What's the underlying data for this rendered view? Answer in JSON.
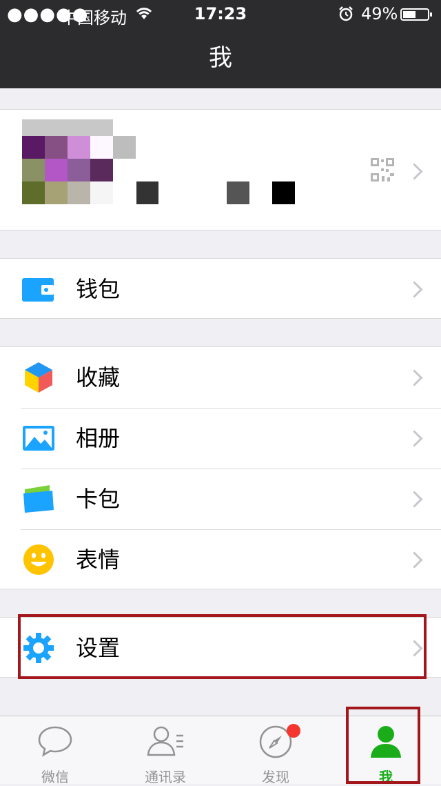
{
  "status": {
    "signal": "●●●●●",
    "carrier": "中国移动",
    "time": "17:23",
    "battery": "49%",
    "battery_level": 0.49
  },
  "nav": {
    "title": "我"
  },
  "profile": {
    "qr_icon": "qr-code-icon",
    "chevron": "chevron-right-icon"
  },
  "groups": {
    "wallet": [
      {
        "label": "钱包",
        "icon": "wallet-icon",
        "color": "#1aa3ff"
      }
    ],
    "media": [
      {
        "label": "收藏",
        "icon": "favorites-cube-icon"
      },
      {
        "label": "相册",
        "icon": "album-icon",
        "color": "#1aa3ff"
      },
      {
        "label": "卡包",
        "icon": "card-package-icon",
        "color": "#1aa3ff"
      },
      {
        "label": "表情",
        "icon": "emoji-smile-icon",
        "color": "#ffc300"
      }
    ],
    "settings": [
      {
        "label": "设置",
        "icon": "gear-icon",
        "color": "#1aa3ff"
      }
    ]
  },
  "tabs": [
    {
      "label": "微信",
      "icon": "chat-bubble-icon",
      "active": false
    },
    {
      "label": "通讯录",
      "icon": "contacts-icon",
      "active": false
    },
    {
      "label": "发现",
      "icon": "compass-icon",
      "active": false,
      "badge": true
    },
    {
      "label": "我",
      "icon": "person-icon",
      "active": true
    }
  ],
  "colors": {
    "accent": "#1aad19",
    "highlight": "#a3171c",
    "badge": "#f43530",
    "navbar": "#2c2c2e"
  }
}
